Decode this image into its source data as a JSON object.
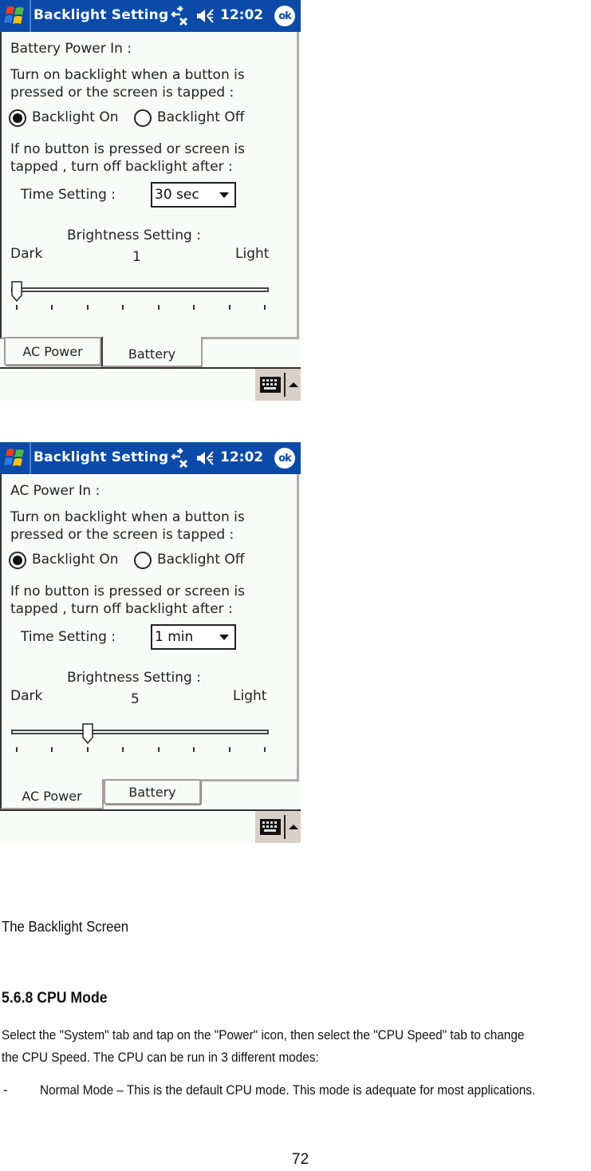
{
  "screens": [
    {
      "id": "battery",
      "titlebar": {
        "app_title": "Backlight Setting",
        "clock": "12:02",
        "ok_label": "ok",
        "icons": [
          "windows-start-icon",
          "connectivity-icon",
          "volume-icon",
          "ok-icon"
        ]
      },
      "section_title": "Battery Power In :",
      "turn_on_text_line1": "Turn on backlight when a button is",
      "turn_on_text_line2": "pressed or the screen is tapped :",
      "radio_on_label": "Backlight On",
      "radio_off_label": "Backlight Off",
      "radio_selected": "on",
      "turn_off_text_line1": "If no button is pressed or screen is",
      "turn_off_text_line2": "tapped , turn off backlight after :",
      "time_label": "Time Setting :",
      "time_value": "30 sec",
      "brightness_label": "Brightness Setting :",
      "dark_label": "Dark",
      "light_label": "Light",
      "brightness_value": "1",
      "slider_tick_count": 8,
      "slider_position_tick": 0,
      "tabs": [
        {
          "label": "AC Power",
          "active": false
        },
        {
          "label": "Battery",
          "active": true
        }
      ]
    },
    {
      "id": "ac",
      "titlebar": {
        "app_title": "Backlight Setting",
        "clock": "12:02",
        "ok_label": "ok",
        "icons": [
          "windows-start-icon",
          "connectivity-icon",
          "volume-icon",
          "ok-icon"
        ]
      },
      "section_title": "AC Power In :",
      "turn_on_text_line1": "Turn on backlight when a button is",
      "turn_on_text_line2": "pressed or the screen is tapped :",
      "radio_on_label": "Backlight On",
      "radio_off_label": "Backlight Off",
      "radio_selected": "on",
      "turn_off_text_line1": "If no button is pressed or screen is",
      "turn_off_text_line2": "tapped , turn off backlight after :",
      "time_label": "Time Setting :",
      "time_value": "1 min",
      "brightness_label": "Brightness Setting :",
      "dark_label": "Dark",
      "light_label": "Light",
      "brightness_value": "5",
      "slider_tick_count": 8,
      "slider_position_tick": 2,
      "tabs": [
        {
          "label": "AC Power",
          "active": true
        },
        {
          "label": "Battery",
          "active": false
        }
      ]
    }
  ],
  "menubar": {
    "icons": [
      "keyboard-icon",
      "sip-up-arrow-icon"
    ]
  },
  "document": {
    "caption": "The Backlight Screen",
    "heading": "5.6.8 CPU Mode",
    "paragraph_line1": "Select the \"System\" tab and tap on the \"Power\" icon, then select the \"CPU Speed\" tab to change",
    "paragraph_line2": "the CPU Speed. The CPU can be run in 3 different modes:",
    "bullet_marker": "-",
    "bullet_text": "Normal Mode – This is the default CPU mode. This mode is adequate for most applications.",
    "page_number": "72"
  },
  "colors": {
    "titlebar_blue": "#0b4aa8",
    "screen_bg": "#f7fcf9",
    "sip_bg": "#d8cfc7"
  }
}
